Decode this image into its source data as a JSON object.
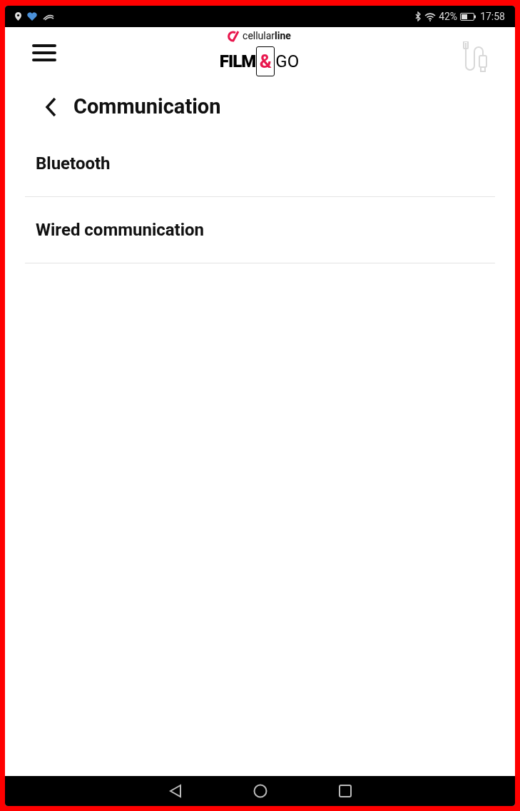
{
  "status_bar": {
    "battery": "42%",
    "time": "17:58"
  },
  "header": {
    "brand": "cellular**line**",
    "logo_parts": [
      "FILM",
      "&",
      "GO"
    ]
  },
  "page": {
    "title": "Communication"
  },
  "items": [
    {
      "label": "Bluetooth"
    },
    {
      "label": "Wired communication"
    }
  ]
}
